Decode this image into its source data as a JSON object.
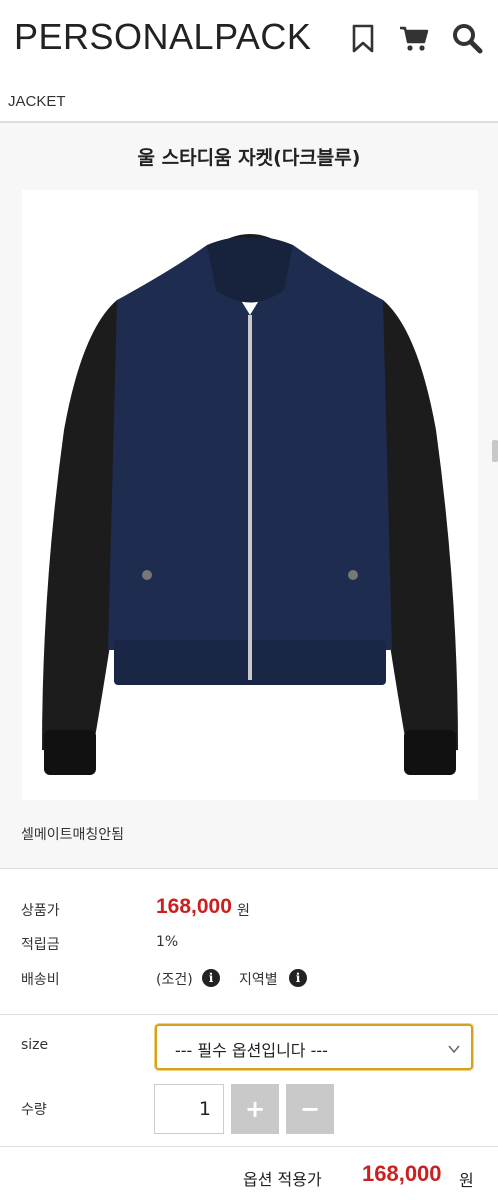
{
  "header": {
    "logo": "PERSONALPACK",
    "icons": [
      "bookmark-icon",
      "cart-icon",
      "search-icon"
    ]
  },
  "breadcrumb": "JACKET",
  "product": {
    "title": "울 스타디움 자켓(다크블루)",
    "image_alt": "navy wool stadium jacket with black leather sleeves",
    "caption": "셀메이트매칭안됨"
  },
  "info": {
    "price_label": "상품가",
    "price_value": "168,000",
    "price_unit": "원",
    "points_label": "적립금",
    "points_value": "1%",
    "shipping_label": "배송비",
    "shipping_condition": "(조건)",
    "shipping_region": "지역별"
  },
  "options": {
    "size_label": "size",
    "size_placeholder": "--- 필수 옵션입니다 ---",
    "qty_label": "수량",
    "qty_value": "1",
    "plus": "+",
    "minus": "−"
  },
  "total": {
    "label": "옵션 적용가",
    "value": "168,000",
    "unit": "원"
  },
  "colors": {
    "accent_price": "#cc1f1f",
    "select_border": "#d6a21e",
    "button_grey": "#c9c9c9"
  }
}
